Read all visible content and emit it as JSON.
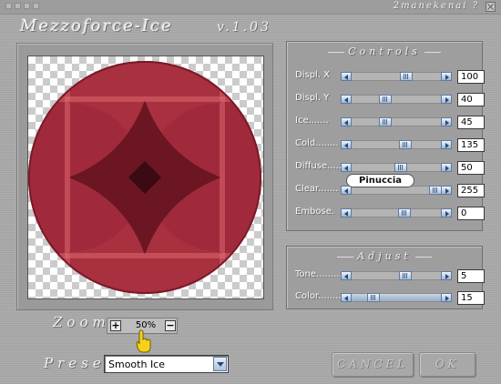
{
  "app": {
    "title": "Mezzoforce-Ice",
    "version": "v.1.03",
    "brand": "2manekenai ?"
  },
  "controls": {
    "title": "Controls",
    "rows": [
      {
        "label": "Displ. X",
        "value": "100",
        "level": 0.62
      },
      {
        "label": "Displ. Y",
        "value": "40",
        "level": 0.35
      },
      {
        "label": "Ice.......",
        "value": "45",
        "level": 0.35
      },
      {
        "label": "Cold........",
        "value": "135",
        "level": 0.61
      },
      {
        "label": "Diffuse.......",
        "value": "50",
        "level": 0.55
      },
      {
        "label": "Clear.......",
        "value": "255",
        "level": 1.0
      },
      {
        "label": "Embose.",
        "value": "0",
        "level": 0.6
      }
    ]
  },
  "adjust": {
    "title": "Adjust",
    "rows": [
      {
        "label": "Tone.........",
        "value": "5",
        "level": 0.61
      },
      {
        "label": "Color.........",
        "value": "15",
        "level": 0.19
      }
    ]
  },
  "watermark": "Pinuccia",
  "zoom": {
    "label": "Zoom",
    "value": "50%",
    "plus": "+",
    "minus": "−"
  },
  "preset": {
    "label": "Preset",
    "value": "Smooth Ice"
  },
  "buttons": {
    "cancel": "CANCEL",
    "ok": "OK"
  },
  "colors": {
    "main_red": "#a0283a",
    "dark_red": "#6b1622",
    "highlight": "#e8747a"
  }
}
